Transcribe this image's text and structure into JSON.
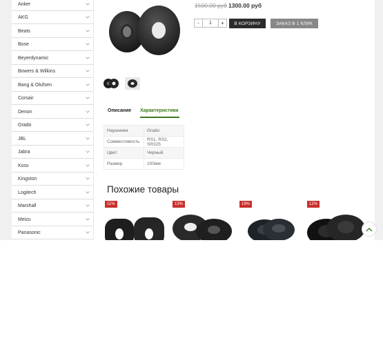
{
  "sidebar": {
    "brands": [
      "Anker",
      "AKG",
      "Beats",
      "Bose",
      "Beyerdynamic",
      "Bowers & Wilkins",
      "Bang & Olufsen",
      "Corsair",
      "Denon",
      "Grado",
      "JBL",
      "Jabra",
      "Koss",
      "Kingston",
      "Logitech",
      "Marshall",
      "Meizu",
      "Panasonic"
    ]
  },
  "product": {
    "price_old": "1500.00 руб",
    "price_new": "1300.00 руб",
    "quantity": "1",
    "qty_minus": "-",
    "qty_plus": "+",
    "add_to_cart": "В КОРЗИНУ",
    "one_click": "ЗАКАЗ В 1 КЛИК"
  },
  "tabs": {
    "description": "Описание",
    "specs": "Характеристики"
  },
  "specs": [
    {
      "key": "Наушники",
      "value": "Grado"
    },
    {
      "key": "Совместимость",
      "value": "RS1, RS2, SR325"
    },
    {
      "key": "Цвет",
      "value": "Черный"
    },
    {
      "key": "Размер",
      "value": "100мм"
    }
  ],
  "similar": {
    "title": "Похожие товары",
    "items": [
      {
        "discount": "11%"
      },
      {
        "discount": "13%"
      },
      {
        "discount": "19%"
      },
      {
        "discount": "12%"
      }
    ]
  },
  "colors": {
    "accent_green": "#3a7a1c",
    "badge_red": "#c9302c",
    "cart_button": "#2b2b2b",
    "oneclick_button": "#888888"
  },
  "icons": {
    "brand_chevron": "chevron-down-icon",
    "scroll_top": "chevron-up-icon"
  }
}
